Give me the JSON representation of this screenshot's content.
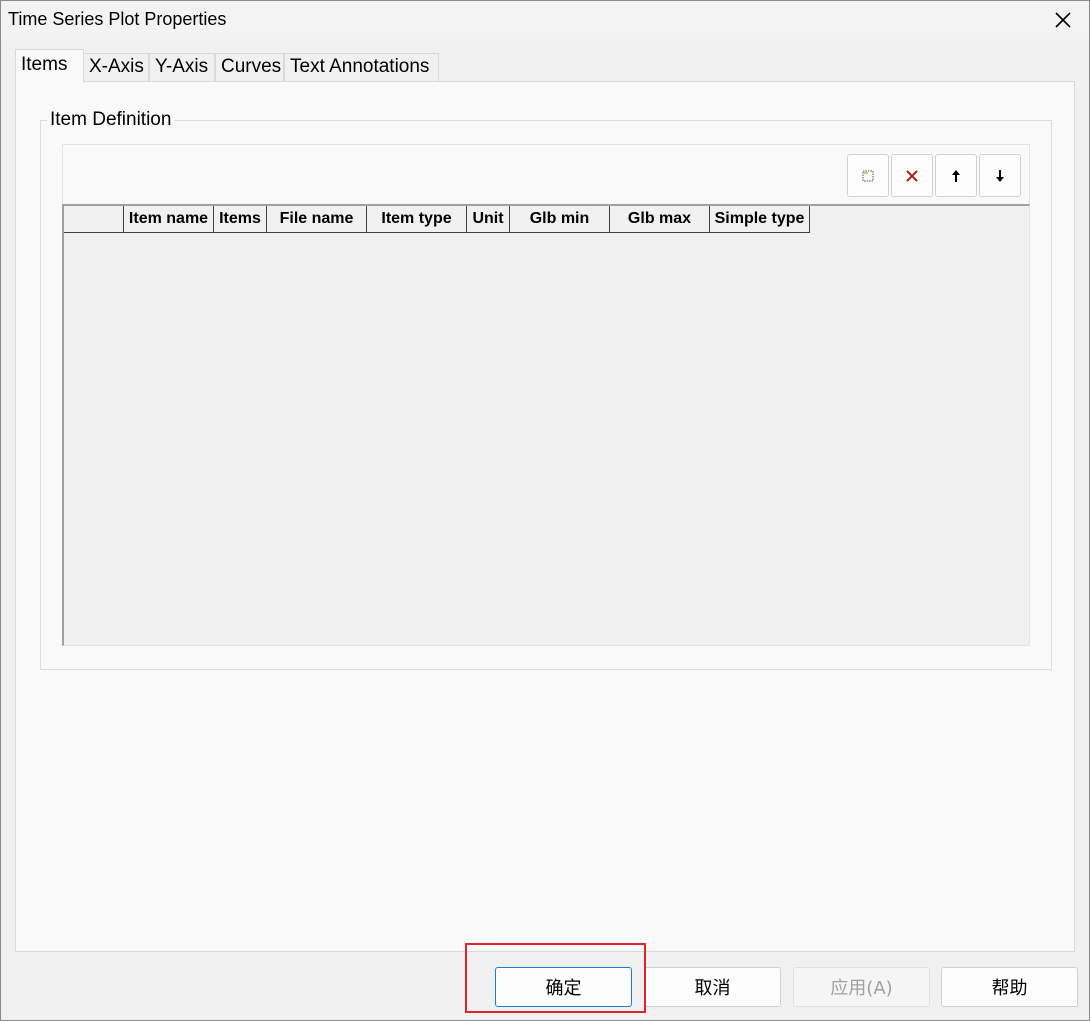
{
  "window": {
    "title": "Time Series Plot Properties"
  },
  "tabs": [
    {
      "label": "Items",
      "active": true
    },
    {
      "label": "X-Axis",
      "active": false
    },
    {
      "label": "Y-Axis",
      "active": false
    },
    {
      "label": "Curves",
      "active": false
    },
    {
      "label": "Text Annotations",
      "active": false
    }
  ],
  "item_definition": {
    "legend": "Item Definition",
    "toolbar": {
      "new_icon": "new-item-icon",
      "delete_icon": "delete-item-icon",
      "up_icon": "move-up-icon",
      "down_icon": "move-down-icon"
    },
    "columns": [
      "",
      "Item name",
      "Items",
      "File name",
      "Item type",
      "Unit",
      "Glb min",
      "Glb max",
      "Simple type"
    ]
  },
  "buttons": {
    "ok": "确定",
    "cancel": "取消",
    "apply": "应用(A)",
    "help": "帮助"
  },
  "colors": {
    "highlight": "#e0242c",
    "default_button_border": "#1a7fd4"
  }
}
